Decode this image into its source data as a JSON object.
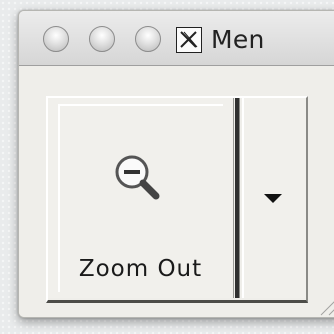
{
  "window": {
    "title": "Men",
    "close_icon": "x-window-icon",
    "traffic_lights": [
      "close-light",
      "minimize-light",
      "zoom-light"
    ]
  },
  "toolbar": {
    "zoom_out": {
      "label": "Zoom Out",
      "icon": "magnifier-minus-icon"
    },
    "dropdown": {
      "icon": "chevron-down-icon"
    }
  },
  "colors": {
    "window_bg": "#efeeea",
    "titlebar_top": "#ececec",
    "titlebar_bottom": "#d6d6d6",
    "divider": "#2f2f2f"
  }
}
